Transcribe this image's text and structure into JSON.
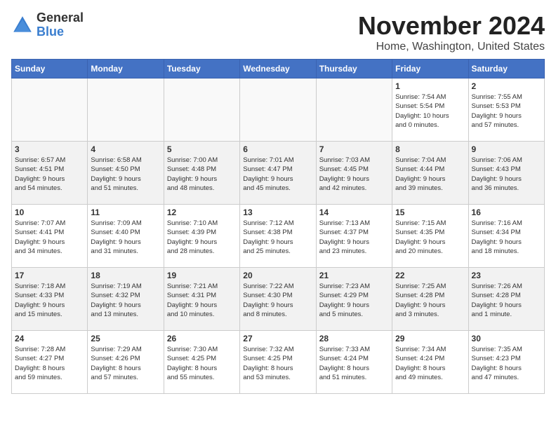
{
  "header": {
    "logo_general": "General",
    "logo_blue": "Blue",
    "month": "November 2024",
    "location": "Home, Washington, United States"
  },
  "weekdays": [
    "Sunday",
    "Monday",
    "Tuesday",
    "Wednesday",
    "Thursday",
    "Friday",
    "Saturday"
  ],
  "weeks": [
    [
      {
        "day": "",
        "info": ""
      },
      {
        "day": "",
        "info": ""
      },
      {
        "day": "",
        "info": ""
      },
      {
        "day": "",
        "info": ""
      },
      {
        "day": "",
        "info": ""
      },
      {
        "day": "1",
        "info": "Sunrise: 7:54 AM\nSunset: 5:54 PM\nDaylight: 10 hours\nand 0 minutes."
      },
      {
        "day": "2",
        "info": "Sunrise: 7:55 AM\nSunset: 5:53 PM\nDaylight: 9 hours\nand 57 minutes."
      }
    ],
    [
      {
        "day": "3",
        "info": "Sunrise: 6:57 AM\nSunset: 4:51 PM\nDaylight: 9 hours\nand 54 minutes."
      },
      {
        "day": "4",
        "info": "Sunrise: 6:58 AM\nSunset: 4:50 PM\nDaylight: 9 hours\nand 51 minutes."
      },
      {
        "day": "5",
        "info": "Sunrise: 7:00 AM\nSunset: 4:48 PM\nDaylight: 9 hours\nand 48 minutes."
      },
      {
        "day": "6",
        "info": "Sunrise: 7:01 AM\nSunset: 4:47 PM\nDaylight: 9 hours\nand 45 minutes."
      },
      {
        "day": "7",
        "info": "Sunrise: 7:03 AM\nSunset: 4:45 PM\nDaylight: 9 hours\nand 42 minutes."
      },
      {
        "day": "8",
        "info": "Sunrise: 7:04 AM\nSunset: 4:44 PM\nDaylight: 9 hours\nand 39 minutes."
      },
      {
        "day": "9",
        "info": "Sunrise: 7:06 AM\nSunset: 4:43 PM\nDaylight: 9 hours\nand 36 minutes."
      }
    ],
    [
      {
        "day": "10",
        "info": "Sunrise: 7:07 AM\nSunset: 4:41 PM\nDaylight: 9 hours\nand 34 minutes."
      },
      {
        "day": "11",
        "info": "Sunrise: 7:09 AM\nSunset: 4:40 PM\nDaylight: 9 hours\nand 31 minutes."
      },
      {
        "day": "12",
        "info": "Sunrise: 7:10 AM\nSunset: 4:39 PM\nDaylight: 9 hours\nand 28 minutes."
      },
      {
        "day": "13",
        "info": "Sunrise: 7:12 AM\nSunset: 4:38 PM\nDaylight: 9 hours\nand 25 minutes."
      },
      {
        "day": "14",
        "info": "Sunrise: 7:13 AM\nSunset: 4:37 PM\nDaylight: 9 hours\nand 23 minutes."
      },
      {
        "day": "15",
        "info": "Sunrise: 7:15 AM\nSunset: 4:35 PM\nDaylight: 9 hours\nand 20 minutes."
      },
      {
        "day": "16",
        "info": "Sunrise: 7:16 AM\nSunset: 4:34 PM\nDaylight: 9 hours\nand 18 minutes."
      }
    ],
    [
      {
        "day": "17",
        "info": "Sunrise: 7:18 AM\nSunset: 4:33 PM\nDaylight: 9 hours\nand 15 minutes."
      },
      {
        "day": "18",
        "info": "Sunrise: 7:19 AM\nSunset: 4:32 PM\nDaylight: 9 hours\nand 13 minutes."
      },
      {
        "day": "19",
        "info": "Sunrise: 7:21 AM\nSunset: 4:31 PM\nDaylight: 9 hours\nand 10 minutes."
      },
      {
        "day": "20",
        "info": "Sunrise: 7:22 AM\nSunset: 4:30 PM\nDaylight: 9 hours\nand 8 minutes."
      },
      {
        "day": "21",
        "info": "Sunrise: 7:23 AM\nSunset: 4:29 PM\nDaylight: 9 hours\nand 5 minutes."
      },
      {
        "day": "22",
        "info": "Sunrise: 7:25 AM\nSunset: 4:28 PM\nDaylight: 9 hours\nand 3 minutes."
      },
      {
        "day": "23",
        "info": "Sunrise: 7:26 AM\nSunset: 4:28 PM\nDaylight: 9 hours\nand 1 minute."
      }
    ],
    [
      {
        "day": "24",
        "info": "Sunrise: 7:28 AM\nSunset: 4:27 PM\nDaylight: 8 hours\nand 59 minutes."
      },
      {
        "day": "25",
        "info": "Sunrise: 7:29 AM\nSunset: 4:26 PM\nDaylight: 8 hours\nand 57 minutes."
      },
      {
        "day": "26",
        "info": "Sunrise: 7:30 AM\nSunset: 4:25 PM\nDaylight: 8 hours\nand 55 minutes."
      },
      {
        "day": "27",
        "info": "Sunrise: 7:32 AM\nSunset: 4:25 PM\nDaylight: 8 hours\nand 53 minutes."
      },
      {
        "day": "28",
        "info": "Sunrise: 7:33 AM\nSunset: 4:24 PM\nDaylight: 8 hours\nand 51 minutes."
      },
      {
        "day": "29",
        "info": "Sunrise: 7:34 AM\nSunset: 4:24 PM\nDaylight: 8 hours\nand 49 minutes."
      },
      {
        "day": "30",
        "info": "Sunrise: 7:35 AM\nSunset: 4:23 PM\nDaylight: 8 hours\nand 47 minutes."
      }
    ]
  ]
}
